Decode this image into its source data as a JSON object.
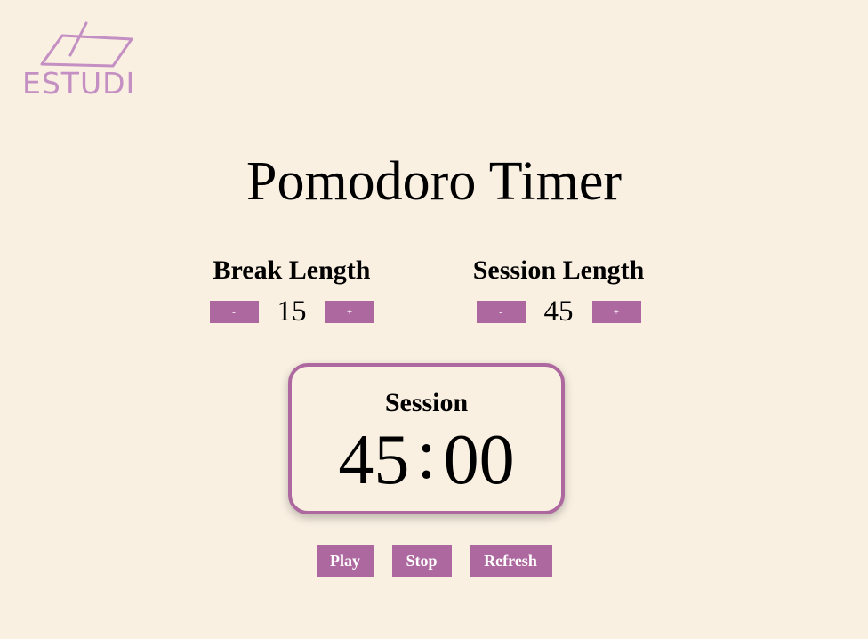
{
  "logo": {
    "text": "ESTUDI",
    "color": "#c48fc2",
    "icon": "notebook-pencil-icon"
  },
  "title": "Pomodoro Timer",
  "break": {
    "label": "Break Length",
    "decrement_label": "-",
    "increment_label": "+",
    "value": "15"
  },
  "session": {
    "label": "Session Length",
    "decrement_label": "-",
    "increment_label": "+",
    "value": "45"
  },
  "timer": {
    "label": "Session",
    "minutes": "45",
    "separator": ":",
    "seconds": "00"
  },
  "controls": {
    "play_label": "Play",
    "stop_label": "Stop",
    "refresh_label": "Refresh"
  },
  "colors": {
    "background": "#f9f0e2",
    "accent": "#ad699f"
  }
}
